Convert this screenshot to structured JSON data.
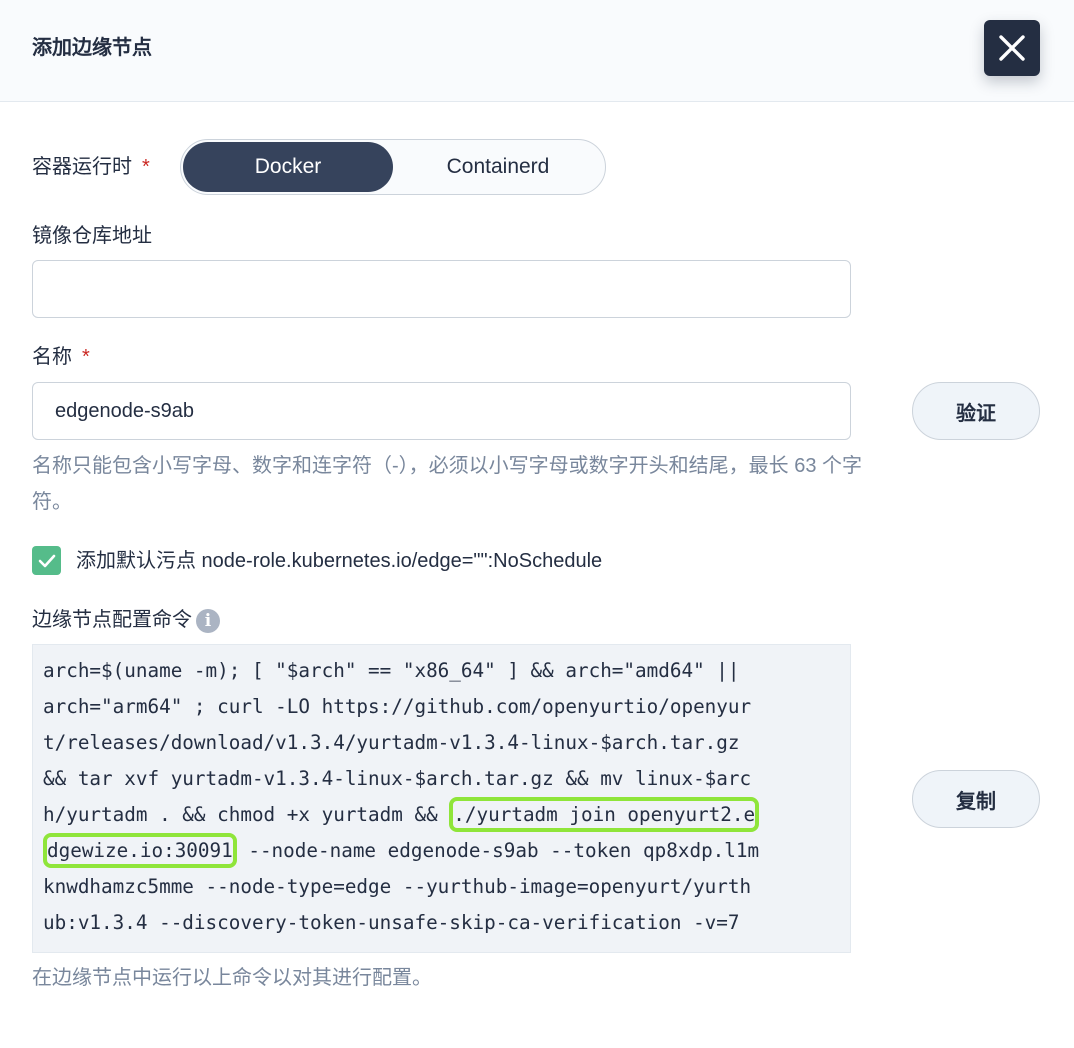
{
  "dialog": {
    "title": "添加边缘节点"
  },
  "runtime": {
    "label": "容器运行时",
    "required_mark": "*",
    "options": [
      "Docker",
      "Containerd"
    ],
    "selected": "Docker"
  },
  "registry": {
    "label": "镜像仓库地址",
    "value": ""
  },
  "name_field": {
    "label": "名称",
    "required_mark": "*",
    "value": "edgenode-s9ab",
    "verify_label": "验证",
    "hint": "名称只能包含小写字母、数字和连字符（-），必须以小写字母或数字开头和结尾，最长 63 个字符。"
  },
  "taint": {
    "checked": true,
    "label": "添加默认污点 node-role.kubernetes.io/edge=\"\":NoSchedule"
  },
  "command": {
    "label": "边缘节点配置命令",
    "info_icon": "i",
    "lines": [
      "arch=$(uname -m); [ \"$arch\" == \"x86_64\" ] && arch=\"amd64\" ||",
      "arch=\"arm64\" ; curl -LO https://github.com/openyurtio/openyur",
      "t/releases/download/v1.3.4/yurtadm-v1.3.4-linux-$arch.tar.gz",
      "&& tar xvf yurtadm-v1.3.4-linux-$arch.tar.gz && mv linux-$arc"
    ],
    "line5_pre": "h/yurtadm . && chmod +x yurtadm && ",
    "line5_hl": "./yurtadm join openyurt2.e",
    "line6_hl": "dgewize.io:30091",
    "line6_post": " --node-name edgenode-s9ab --token qp8xdp.l1m",
    "lines_tail": [
      "knwdhamzc5mme --node-type=edge --yurthub-image=openyurt/yurth",
      "ub:v1.3.4 --discovery-token-unsafe-skip-ca-verification -v=7"
    ],
    "copy_label": "复制",
    "hint": "在边缘节点中运行以上命令以对其进行配置。"
  }
}
